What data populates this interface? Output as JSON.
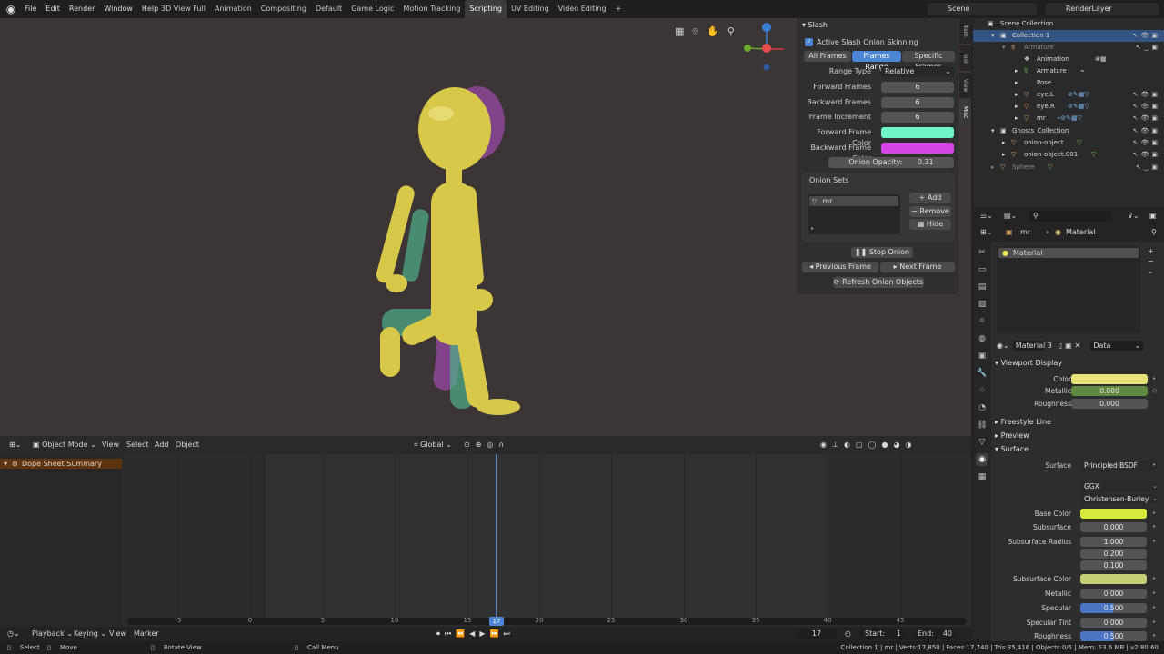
{
  "menus": [
    "File",
    "Edit",
    "Render",
    "Window",
    "Help"
  ],
  "workspaces": [
    "3D View Full",
    "Animation",
    "Compositing",
    "Default",
    "Game Logic",
    "Motion Tracking",
    "Scripting",
    "UV Editing",
    "Video Editing"
  ],
  "active_workspace": "Scripting",
  "scene": "Scene",
  "render_layer": "RenderLayer",
  "viewport_header": {
    "mode": "Object Mode",
    "menu": [
      "View",
      "Select",
      "Add",
      "Object"
    ],
    "transform": "Global"
  },
  "npanel": {
    "title": "Slash",
    "tabs": [
      "Item",
      "Tool",
      "View",
      "Misc"
    ],
    "active_label": "Active Slash Onion Skinning",
    "frame_modes": [
      "All Frames",
      "Frames Range",
      "Specific Frames"
    ],
    "active_mode": "Frames Range",
    "range_type_label": "Range Type",
    "range_type_value": "Relative",
    "forward_frames_label": "Forward Frames",
    "forward_frames": "6",
    "backward_frames_label": "Backward Frames",
    "backward_frames": "6",
    "frame_increment_label": "Frame Increment",
    "frame_increment": "6",
    "forward_color_label": "Forward Frame Color",
    "forward_color": "#6ff5c8",
    "backward_color_label": "Backward Frame Color",
    "backward_color": "#d646e6",
    "opacity_label": "Onion Opacity:",
    "opacity": "0.31",
    "onion_sets_title": "Onion Sets",
    "onion_set_item": "mr",
    "add": "Add",
    "remove": "Remove",
    "hide": "Hide",
    "stop_onion": "Stop Onion",
    "previous_frame": "Previous Frame",
    "next_frame": "Next Frame",
    "refresh": "Refresh Onion Objects"
  },
  "dopesheet": {
    "summary": "Dope Sheet Summary",
    "ticks": [
      "-5",
      "0",
      "5",
      "10",
      "15",
      "20",
      "25",
      "30",
      "35",
      "40",
      "45"
    ],
    "current_frame": "17"
  },
  "timeline": {
    "menu": [
      "Playback",
      "Keying",
      "View",
      "Marker"
    ],
    "frame": "17",
    "start_label": "Start:",
    "start": "1",
    "end_label": "End:",
    "end": "40"
  },
  "statusbar": {
    "select": "Select",
    "move": "Move",
    "rotate": "Rotate View",
    "call_menu": "Call Menu",
    "info": "Collection 1 | mr | Verts:17,850 | Faces:17,740 | Tris:35,416 | Objects:0/5 | Mem: 53.6 MB | v2.80.60"
  },
  "outliner": {
    "rows": [
      {
        "name": "Scene Collection",
        "indent": 0
      },
      {
        "name": "Collection 1",
        "indent": 1
      },
      {
        "name": "Armature",
        "indent": 2
      },
      {
        "name": "Animation",
        "indent": 3
      },
      {
        "name": "Armature",
        "indent": 3
      },
      {
        "name": "Pose",
        "indent": 3
      },
      {
        "name": "eye.L",
        "indent": 3
      },
      {
        "name": "eye.R",
        "indent": 3
      },
      {
        "name": "mr",
        "indent": 3
      },
      {
        "name": "Ghosts_Collection",
        "indent": 1
      },
      {
        "name": "onion-object",
        "indent": 2
      },
      {
        "name": "onion-object.001",
        "indent": 2
      },
      {
        "name": "Sphere",
        "indent": 1
      }
    ]
  },
  "properties": {
    "object": "mr",
    "material_header": "Material",
    "slot": "Material",
    "material_name": "Material",
    "users": "3",
    "link": "Data",
    "viewport_display": "Viewport Display",
    "color_label": "Color",
    "vd_color": "#e8e27a",
    "metallic_label": "Metallic",
    "metallic": "0.000",
    "roughness_label": "Roughness",
    "roughness": "0.000",
    "freestyle": "Freestyle Line",
    "preview": "Preview",
    "surface_section": "Surface",
    "surface_label": "Surface",
    "surface": "Principled BSDF",
    "distribution": "GGX",
    "subsurface_method": "Christensen-Burley",
    "base_color_label": "Base Color",
    "base_color": "#d6ea3c",
    "subsurface_label": "Subsurface",
    "subsurface": "0.000",
    "subsurface_radius_label": "Subsurface Radius",
    "radius": [
      "1.000",
      "0.200",
      "0.100"
    ],
    "subsurface_color_label": "Subsurface Color",
    "subsurface_color": "#c5cf78",
    "metallic2_label": "Metallic",
    "metallic2": "0.000",
    "specular_label": "Specular",
    "specular": "0.500",
    "specular_tint_label": "Specular Tint",
    "specular_tint": "0.000",
    "roughness2_label": "Roughness",
    "roughness2": "0.500"
  }
}
